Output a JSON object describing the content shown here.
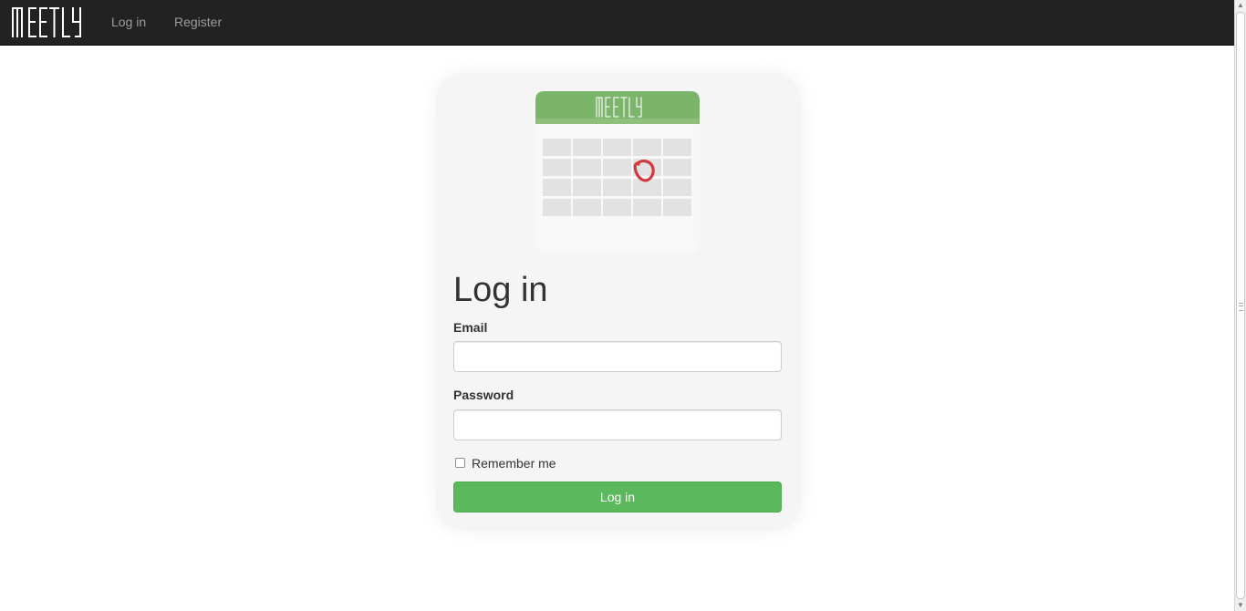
{
  "navbar": {
    "brand": "MEETLY",
    "links": [
      {
        "label": "Log in"
      },
      {
        "label": "Register"
      }
    ]
  },
  "logo": {
    "header_text": "MEETLY",
    "header_color": "#7bb56a",
    "marker_color": "#d0393e"
  },
  "form": {
    "title": "Log in",
    "email_label": "Email",
    "email_value": "",
    "password_label": "Password",
    "password_value": "",
    "remember_label": "Remember me",
    "remember_checked": false,
    "submit_label": "Log in"
  },
  "colors": {
    "navbar_bg": "#222222",
    "card_bg": "#f5f5f5",
    "button_bg": "#5cb85c"
  }
}
